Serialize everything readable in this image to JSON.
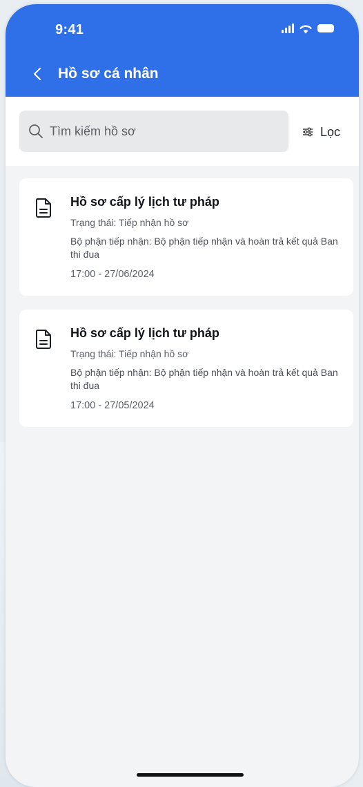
{
  "status_bar": {
    "time": "9:41"
  },
  "header": {
    "title": "Hồ sơ cá nhân"
  },
  "search": {
    "placeholder": "Tìm kiếm hồ sơ",
    "value": ""
  },
  "filter": {
    "label": "Lọc"
  },
  "records": [
    {
      "title": "Hồ sơ cấp lý lịch tư pháp",
      "status": "Trạng thái: Tiếp nhận hồ sơ",
      "department": "Bộ phận tiếp nhận: Bộ phận tiếp nhận và hoàn trả kết quả Ban thi đua",
      "time": "17:00 - 27/06/2024"
    },
    {
      "title": "Hồ sơ cấp lý lịch tư pháp",
      "status": "Trạng thái: Tiếp nhận hồ sơ",
      "department": "Bộ phận tiếp nhận: Bộ phận tiếp nhận và hoàn trả kết quả Ban thi đua",
      "time": "17:00 - 27/05/2024"
    }
  ],
  "colors": {
    "primary": "#2f6fe8",
    "background": "#f3f4f6",
    "card": "#ffffff",
    "search_bg": "#e8e9eb"
  },
  "icons": {
    "back": "chevron-left-icon",
    "search": "search-icon",
    "filter": "filter-sliders-icon",
    "record": "document-icon"
  }
}
